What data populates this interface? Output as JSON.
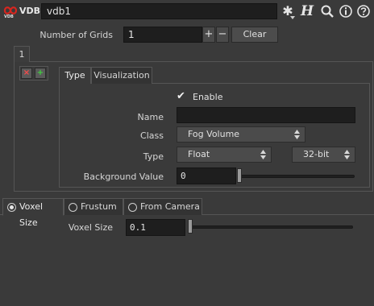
{
  "header": {
    "node_type": "VDB",
    "node_name": "vdb1",
    "icons": [
      "vdb-logo-icon",
      "gear-icon",
      "help-h-icon",
      "search-icon",
      "info-icon",
      "help-circle-icon"
    ],
    "help_h_glyph": "H"
  },
  "grids": {
    "label": "Number of Grids",
    "value": "1",
    "add_label": "+",
    "remove_label": "−",
    "clear_label": "Clear",
    "instance_tab_label": "1",
    "remove_instance_glyph": "×",
    "insert_instance_glyph": "+"
  },
  "inner_tabs": {
    "type_label": "Type",
    "visualization_label": "Visualization",
    "active": "Type"
  },
  "form": {
    "enable_label": "Enable",
    "enable_checked": true,
    "check_glyph": "✔",
    "name_label": "Name",
    "name_value": "",
    "class_label": "Class",
    "class_value": "Fog Volume",
    "type_label": "Type",
    "type_value": "Float",
    "precision_value": "32-bit",
    "background_label": "Background Value",
    "background_value": "0",
    "background_slider_fraction": 0.0
  },
  "bottom_tabs": {
    "voxel_size_label": "Voxel Size",
    "frustum_label": "Frustum",
    "from_camera_label": "From Camera",
    "selected": "Voxel Size"
  },
  "voxel": {
    "label": "Voxel Size",
    "value": "0.1",
    "slider_fraction": 0.0
  },
  "colors": {
    "background": "#3a3a3a",
    "field": "#1e1e1e",
    "remove_red": "#ff4a4a",
    "insert_green": "#3fd23f",
    "logo_red": "#d8261f"
  }
}
